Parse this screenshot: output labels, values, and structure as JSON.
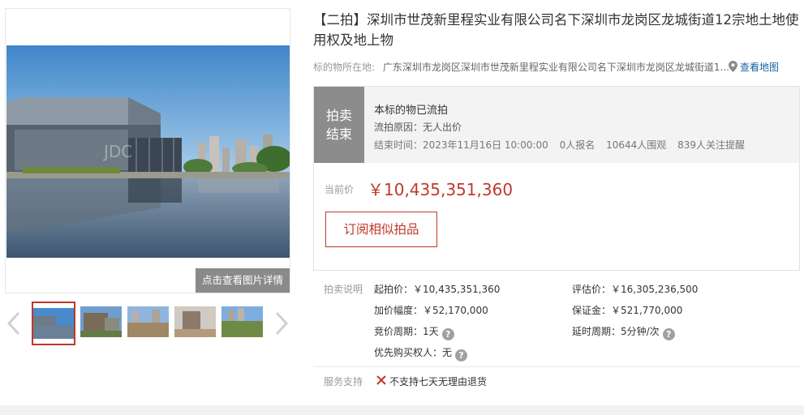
{
  "gallery": {
    "watermark": "JDC",
    "detail_button": "点击查看图片详情",
    "thumbnails": [
      "thumb-1",
      "thumb-2",
      "thumb-3",
      "thumb-4",
      "thumb-5"
    ]
  },
  "title": "【二拍】深圳市世茂新里程实业有限公司名下深圳市龙岗区龙城街道12宗地土地使用权及地上物",
  "location": {
    "label": "标的物所在地:",
    "value": "广东深圳市龙岗区深圳市世茂新里程实业有限公司名下深圳市龙岗区龙城街道1...",
    "map_link": "查看地图"
  },
  "status": {
    "badge_line1": "拍卖",
    "badge_line2": "结束",
    "title": "本标的物已流拍",
    "reason": "流拍原因：无人出价",
    "end_time": "结束时间：2023年11月16日 10:00:00",
    "signups": "0人报名",
    "viewers": "10644人围观",
    "followers": "839人关注提醒"
  },
  "price": {
    "label": "当前价",
    "value": "￥10,435,351,360"
  },
  "subscribe_button": "订阅相似拍品",
  "details": {
    "label": "拍卖说明",
    "starting_price": "起拍价：￥10,435,351,360",
    "appraisal": "评估价：￥16,305,236,500",
    "increment": "加价幅度：￥52,170,000",
    "deposit": "保证金：￥521,770,000",
    "bidding_period": "竞价周期：1天",
    "extension_period": "延时周期：5分钟/次",
    "priority_buyer": "优先购买权人：无"
  },
  "service": {
    "label": "服务支持",
    "text": "不支持七天无理由退货"
  },
  "colors": {
    "accent": "#c0392b",
    "link": "#1a5fa8",
    "badge_bg": "#8c8c8c"
  }
}
